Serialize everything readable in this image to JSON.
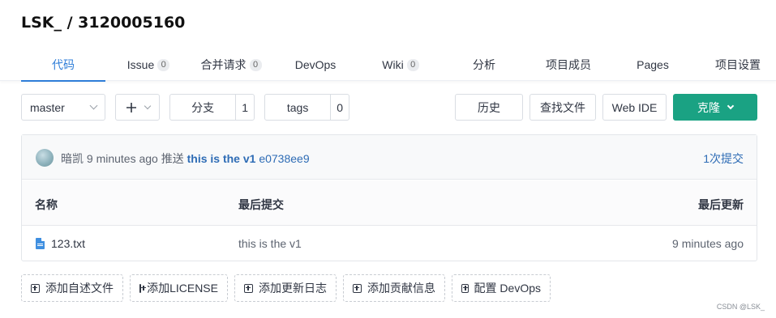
{
  "repo": {
    "title": "LSK_ / 3120005160"
  },
  "tabs": [
    {
      "label": "代码",
      "count": null,
      "active": true
    },
    {
      "label": "Issue",
      "count": "0"
    },
    {
      "label": "合并请求",
      "count": "0"
    },
    {
      "label": "DevOps",
      "count": null
    },
    {
      "label": "Wiki",
      "count": "0"
    },
    {
      "label": "分析",
      "count": null
    },
    {
      "label": "项目成员",
      "count": null
    },
    {
      "label": "Pages",
      "count": null
    },
    {
      "label": "项目设置",
      "count": null
    }
  ],
  "toolbar": {
    "branch": "master",
    "add_icon": "plus-icon",
    "branches_label": "分支",
    "branches_count": "1",
    "tags_label": "tags",
    "tags_count": "0",
    "history": "历史",
    "find_file": "查找文件",
    "web_ide": "Web IDE",
    "clone": "克隆"
  },
  "commit": {
    "author": "暗凯",
    "time": "9 minutes ago",
    "action": "推送",
    "message": "this is the v1",
    "sha": "e0738ee9",
    "count_label": "1次提交"
  },
  "table": {
    "headers": {
      "name": "名称",
      "last_commit": "最后提交",
      "last_update": "最后更新"
    },
    "rows": [
      {
        "name": "123.txt",
        "commit": "this is the v1",
        "updated": "9 minutes ago"
      }
    ]
  },
  "actions": [
    "添加自述文件",
    "添加LICENSE",
    "添加更新日志",
    "添加贡献信息",
    "配置 DevOps"
  ],
  "watermark": "CSDN @LSK_",
  "colors": {
    "accent": "#2e7dd8",
    "clone": "#1aa283",
    "link": "#2e6cb5"
  }
}
